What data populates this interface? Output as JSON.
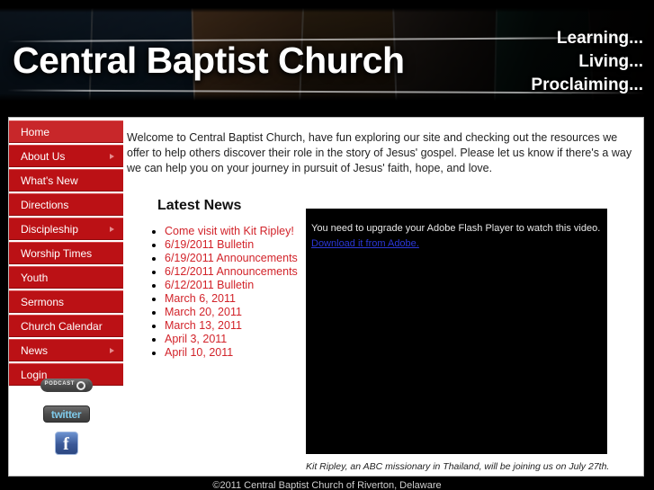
{
  "header": {
    "site_title": "Central Baptist Church",
    "tagline": [
      "Learning...",
      "Living...",
      "Proclaiming..."
    ]
  },
  "sidebar": {
    "items": [
      {
        "label": "Home",
        "active": true,
        "arrow": false
      },
      {
        "label": "About Us",
        "active": false,
        "arrow": true
      },
      {
        "label": "What's New",
        "active": false,
        "arrow": false
      },
      {
        "label": "Directions",
        "active": false,
        "arrow": false
      },
      {
        "label": "Discipleship",
        "active": false,
        "arrow": true
      },
      {
        "label": "Worship Times",
        "active": false,
        "arrow": false
      },
      {
        "label": "Youth",
        "active": false,
        "arrow": false
      },
      {
        "label": "Sermons",
        "active": false,
        "arrow": false
      },
      {
        "label": "Church Calendar",
        "active": false,
        "arrow": false
      },
      {
        "label": "News",
        "active": false,
        "arrow": true
      },
      {
        "label": "Login",
        "active": false,
        "arrow": false
      }
    ],
    "social": {
      "podcast_label": "PODCAST",
      "twitter_label": "twitter",
      "facebook_label": "f"
    }
  },
  "main": {
    "welcome_text": "Welcome to Central Baptist Church, have fun exploring our site and checking out the resources we offer to help others discover their role in the story of Jesus' gospel.  Please let us know if there's a way we can help you on your journey in pursuit of Jesus' faith, hope, and love.",
    "latest_news_title": "Latest News",
    "news_items": [
      "Come visit with Kit Ripley!",
      "6/19/2011 Bulletin",
      "6/19/2011 Announcements",
      "6/12/2011 Announcements",
      "6/12/2011 Bulletin",
      "March 6, 2011",
      "March 20, 2011",
      "March 13, 2011",
      "April 3, 2011",
      "April 10, 2011"
    ],
    "video": {
      "flash_message": "You need to upgrade your Adobe Flash Player to watch this video.",
      "flash_link_label": "Download it from Adobe.",
      "caption": "Kit Ripley, an ABC missionary in Thailand, will be joining us on July 27th."
    }
  },
  "footer": {
    "copyright": "©2011 Central Baptist Church of Riverton, Delaware"
  },
  "colors": {
    "nav_red": "#bb1115",
    "nav_red_active": "#c8272a",
    "link_red": "#d2232a",
    "link_blue": "#2b37d8",
    "page_black": "#000000"
  }
}
